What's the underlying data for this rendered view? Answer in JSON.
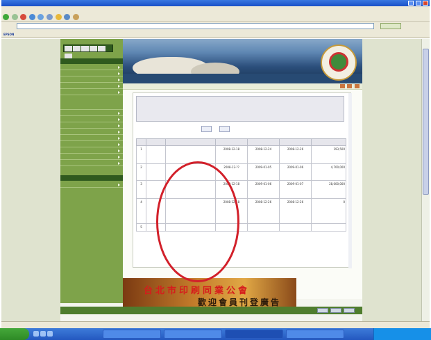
{
  "window": {
    "title": "",
    "menu": [
      "",
      "",
      "",
      "",
      "",
      ""
    ]
  },
  "address": {
    "label": "",
    "url": "",
    "go": ""
  },
  "links": {
    "epson": "EPSON",
    "items": [
      "",
      ""
    ]
  },
  "sidebar": {
    "items": [
      "",
      "",
      "",
      "",
      "",
      "",
      "",
      "",
      "",
      "",
      "",
      "",
      "",
      "",
      "",
      "",
      "",
      ""
    ]
  },
  "content": {
    "breadcrumb": "",
    "notice": {
      "label": "",
      "lines": [
        "",
        "",
        ""
      ]
    },
    "buttons": [
      "",
      ""
    ],
    "table": {
      "headers": [
        "",
        "",
        "",
        "",
        "",
        "",
        ""
      ],
      "rows": [
        {
          "no": "1",
          "org": "",
          "title": "",
          "announce": "2008-12-18",
          "start": "2008-12-24",
          "end": "2008-12-26",
          "amount": "193,500"
        },
        {
          "no": "2",
          "org": "",
          "title": "",
          "announce": "2008-12-??",
          "start": "2009-01-05",
          "end": "2009-01-06",
          "amount": "4,700,000"
        },
        {
          "no": "3",
          "org": "",
          "title": "",
          "announce": "2008-12-18",
          "start": "2009-01-06",
          "end": "2009-01-07",
          "amount": "28,000,000"
        },
        {
          "no": "4",
          "org": "",
          "title": "",
          "announce": "2008-12-18",
          "start": "2008-12-26",
          "end": "2008-12-26",
          "amount": "0"
        },
        {
          "no": "5",
          "org": "",
          "title": "",
          "announce": "",
          "start": "",
          "end": "",
          "amount": ""
        }
      ]
    }
  },
  "emblem": {
    "text": ""
  },
  "ad": {
    "line1": "台北市印刷同業公會",
    "line2": "歡迎會員刊登廣告"
  },
  "footer": {
    "text": ""
  },
  "statusbar": {
    "left": "",
    "zone": ""
  },
  "taskbar": {
    "start": "",
    "tasks": [
      "",
      "",
      "",
      ""
    ],
    "clock": ""
  },
  "colors": {
    "sidebar": "#7ea34a",
    "annotation": "#d2202a",
    "link": "#1f3ea8"
  },
  "icons": [
    "back-icon",
    "forward-icon",
    "stop-icon",
    "refresh-icon",
    "home-icon",
    "search-icon",
    "favorites-icon",
    "print-icon",
    "mail-icon"
  ]
}
